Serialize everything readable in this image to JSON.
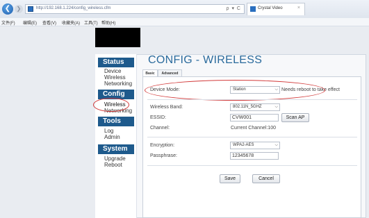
{
  "browser": {
    "back_icon": "back-arrow-icon",
    "back_glyph": "❮",
    "forward_glyph": "❯",
    "url": "http://192.168.1.224/config_wireless.cfm",
    "address_controls": "ρ ▾ C",
    "tab_title": "Crystal Video",
    "tab_close": "×",
    "accent": "#1f5fae"
  },
  "menu": {
    "items": [
      "文件(F)",
      "编辑(E)",
      "查看(V)",
      "收藏夹(A)",
      "工具(T)",
      "帮助(H)"
    ]
  },
  "sidebar": {
    "sections": [
      {
        "header": "Status",
        "items": [
          "Device",
          "Wireless",
          "Networking"
        ]
      },
      {
        "header": "Config",
        "items": [
          "Wireless",
          "Networking"
        ]
      },
      {
        "header": "Tools",
        "items": [
          "Log",
          "Admin"
        ]
      },
      {
        "header": "System",
        "items": [
          "Upgrade",
          "Reboot"
        ]
      }
    ],
    "header_color": "#1e5a8c"
  },
  "page": {
    "title": "CONFIG - WIRELESS",
    "tabs": [
      "Basic",
      "Advanced"
    ],
    "active_tab": "Basic"
  },
  "form": {
    "device_mode": {
      "label": "Device Mode:",
      "value": "Station",
      "note": "Needs reboot to take effect"
    },
    "wireless_band": {
      "label": "Wireless Band:",
      "value": "802.11N_5GHZ"
    },
    "essid": {
      "label": "ESSID:",
      "value": "CVW001"
    },
    "scan_button": "Scan AP",
    "channel": {
      "label": "Channel:",
      "value": "Current Channel:100"
    },
    "encryption": {
      "label": "Encryption:",
      "value": "WPA2-AES"
    },
    "passphrase": {
      "label": "Passphrase:",
      "value": "12345678"
    },
    "save_button": "Save",
    "cancel_button": "Cancel"
  },
  "annotation_color": "#d23a3a"
}
